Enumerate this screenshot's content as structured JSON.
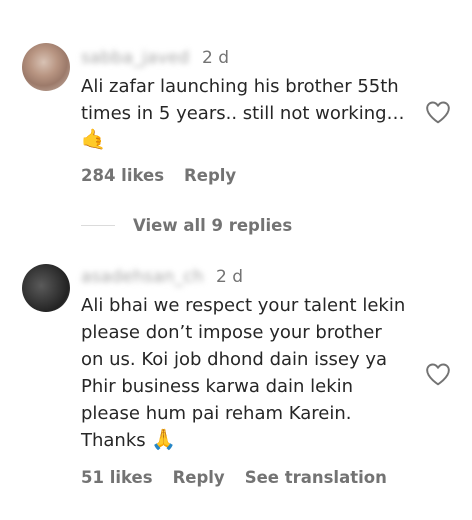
{
  "comments": [
    {
      "username": "sabba_javed",
      "time": "2 d",
      "text": "Ali zafar launching his brother 55th\ntimes in 5 years.. still not working…",
      "emoji": "🤙",
      "likes": "284 likes",
      "reply_label": "Reply"
    },
    {
      "username": "asadehsan_ch",
      "time": "2 d",
      "text": "Ali bhai we respect your talent lekin\nplease don’t impose your brother\non us. Koi job dhond dain issey ya\nPhir business karwa dain lekin\nplease hum pai reham Karein.\nThanks",
      "emoji": "🙏",
      "likes": "51 likes",
      "reply_label": "Reply",
      "translate_label": "See translation"
    }
  ],
  "view_replies_label": "View all 9 replies",
  "icons": {
    "like": "heart-outline-icon"
  }
}
